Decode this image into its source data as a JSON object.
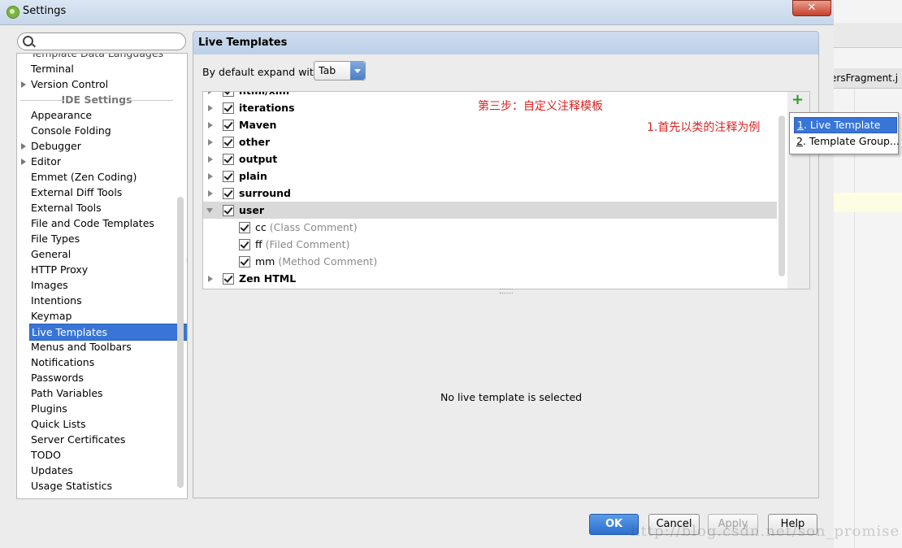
{
  "window": {
    "title": "Settings",
    "close_glyph": "✕"
  },
  "background_ide": {
    "tab_label": "ersFragment.j"
  },
  "search": {
    "placeholder": "",
    "value": ""
  },
  "sidebar": {
    "items_top": [
      {
        "label": "Template Data Languages",
        "expandable": false,
        "cut": true
      },
      {
        "label": "Terminal",
        "expandable": false
      },
      {
        "label": "Version Control",
        "expandable": true
      }
    ],
    "section_label": "IDE Settings",
    "items": [
      {
        "label": "Appearance",
        "expandable": false
      },
      {
        "label": "Console Folding",
        "expandable": false
      },
      {
        "label": "Debugger",
        "expandable": true
      },
      {
        "label": "Editor",
        "expandable": true
      },
      {
        "label": "Emmet (Zen Coding)",
        "expandable": false
      },
      {
        "label": "External Diff Tools",
        "expandable": false
      },
      {
        "label": "External Tools",
        "expandable": false
      },
      {
        "label": "File and Code Templates",
        "expandable": false
      },
      {
        "label": "File Types",
        "expandable": false
      },
      {
        "label": "General",
        "expandable": false
      },
      {
        "label": "HTTP Proxy",
        "expandable": false
      },
      {
        "label": "Images",
        "expandable": false
      },
      {
        "label": "Intentions",
        "expandable": false
      },
      {
        "label": "Keymap",
        "expandable": false
      },
      {
        "label": "Live Templates",
        "expandable": false,
        "selected": true
      },
      {
        "label": "Menus and Toolbars",
        "expandable": false
      },
      {
        "label": "Notifications",
        "expandable": false
      },
      {
        "label": "Passwords",
        "expandable": false
      },
      {
        "label": "Path Variables",
        "expandable": false
      },
      {
        "label": "Plugins",
        "expandable": false
      },
      {
        "label": "Quick Lists",
        "expandable": false
      },
      {
        "label": "Server Certificates",
        "expandable": false
      },
      {
        "label": "TODO",
        "expandable": false
      },
      {
        "label": "Updates",
        "expandable": false
      },
      {
        "label": "Usage Statistics",
        "expandable": false
      }
    ]
  },
  "panel": {
    "title": "Live Templates",
    "expand_label": "By default expand with",
    "expand_value": "Tab",
    "templates": [
      {
        "name": "html/xml",
        "cut": true,
        "expanded": false
      },
      {
        "name": "iterations",
        "expanded": false
      },
      {
        "name": "Maven",
        "expanded": false
      },
      {
        "name": "other",
        "expanded": false
      },
      {
        "name": "output",
        "expanded": false
      },
      {
        "name": "plain",
        "expanded": false
      },
      {
        "name": "surround",
        "expanded": false
      },
      {
        "name": "user",
        "expanded": true,
        "selected": true,
        "children": [
          {
            "abbr": "cc",
            "desc": "(Class Comment)"
          },
          {
            "abbr": "ff",
            "desc": "(Filed Comment)"
          },
          {
            "abbr": "mm",
            "desc": "(Method Comment)"
          }
        ]
      },
      {
        "name": "Zen HTML",
        "expanded": false
      }
    ],
    "add_glyph": "+",
    "popup": {
      "items": [
        {
          "num": "1",
          "label": ". Live Template",
          "selected": true
        },
        {
          "num": "2",
          "label": ". Template Group..."
        }
      ]
    },
    "annotation_step": "第三步：自定义注释模板",
    "annotation_note": "1.首先以类的注释为例",
    "empty_message": "No live template is selected"
  },
  "buttons": {
    "ok": "OK",
    "cancel": "Cancel",
    "apply": "Apply",
    "help": "Help"
  },
  "watermark": "http://blog.csdn.net/son_promise",
  "colors": {
    "selection": "#3875d7",
    "annotation": "#dd2222",
    "ok_button": "#2c6fd0",
    "add_icon": "#2e9a2e"
  }
}
